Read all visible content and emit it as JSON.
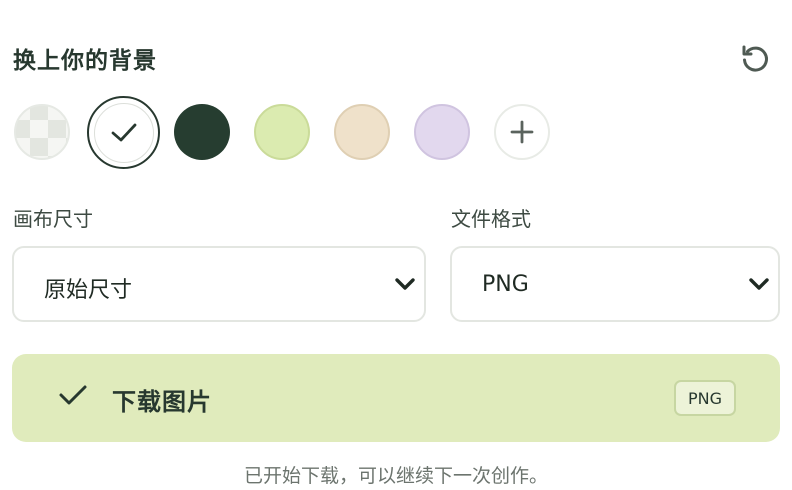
{
  "background_section": {
    "title": "换上你的背景",
    "reset_icon": "reset-icon",
    "swatches": [
      {
        "name": "transparent",
        "icon": "checkerboard-pattern"
      },
      {
        "name": "white",
        "color": "#ffffff",
        "selected": true,
        "icon": "check-icon"
      },
      {
        "name": "dark-green",
        "color": "#263d30"
      },
      {
        "name": "lime",
        "color": "#dbebb0"
      },
      {
        "name": "beige",
        "color": "#efe1ca"
      },
      {
        "name": "lavender",
        "color": "#e2d8ee"
      },
      {
        "name": "add-custom",
        "icon": "plus-icon"
      }
    ]
  },
  "canvas_size": {
    "label": "画布尺寸",
    "value": "原始尺寸"
  },
  "file_format": {
    "label": "文件格式",
    "value": "PNG"
  },
  "download": {
    "label": "下载图片",
    "badge": "PNG",
    "color": "#e0ebbc"
  },
  "status": {
    "message": "已开始下载，可以继续下一次创作。"
  }
}
